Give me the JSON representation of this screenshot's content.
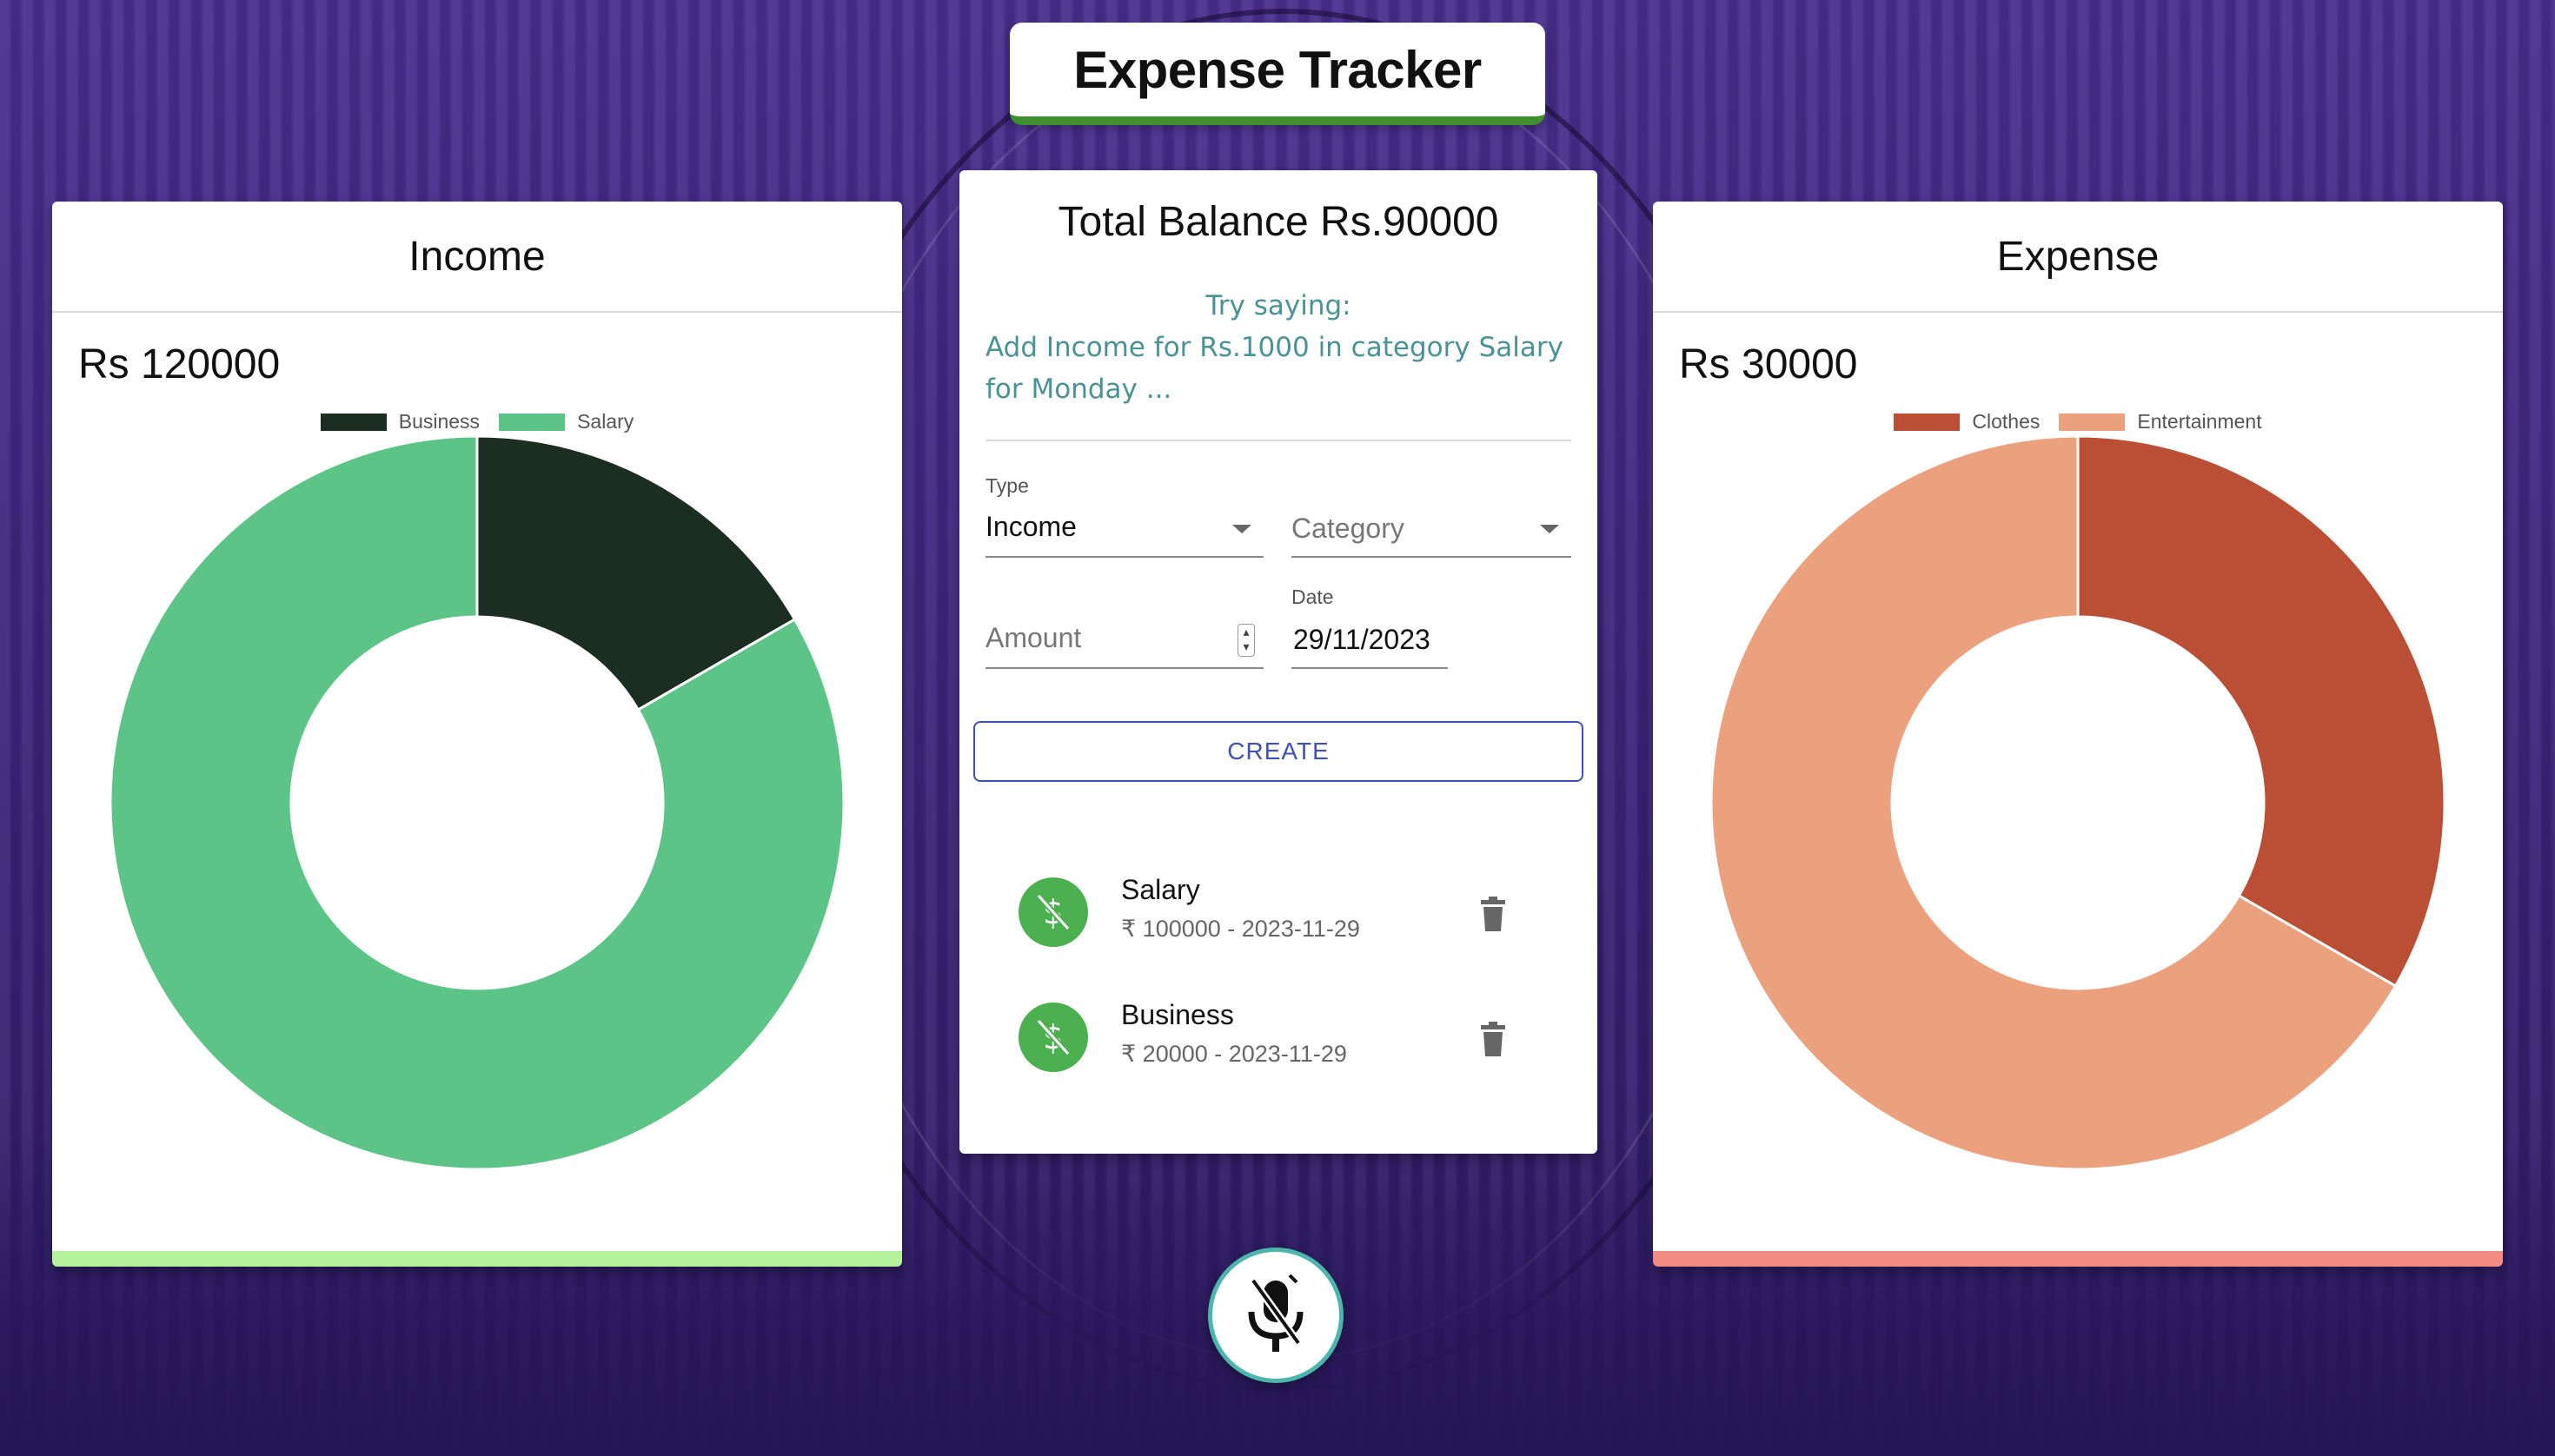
{
  "app": {
    "title": "Expense Tracker"
  },
  "income_card": {
    "heading": "Income",
    "total": "Rs 120000",
    "legend": [
      "Business",
      "Salary"
    ],
    "accent": "#b6f19b"
  },
  "expense_card": {
    "heading": "Expense",
    "total": "Rs 30000",
    "legend": [
      "Clothes",
      "Entertainment"
    ],
    "accent": "#f28b82"
  },
  "chart_data": [
    {
      "type": "pie",
      "categories": [
        "Business",
        "Salary"
      ],
      "values": [
        20000,
        100000
      ],
      "colors": [
        "#1c2e22",
        "#5cc486"
      ],
      "title": "",
      "legend_position": "top-center"
    },
    {
      "type": "pie",
      "categories": [
        "Clothes",
        "Entertainment"
      ],
      "values": [
        10000,
        20000
      ],
      "colors": [
        "#bb4f36",
        "#eba07e"
      ],
      "title": "",
      "legend_position": "top-center"
    }
  ],
  "form": {
    "balance": "Total Balance Rs.90000",
    "hint_title": "Try saying:",
    "hint_body": "Add Income for Rs.1000 in category Salary for Monday ...",
    "type_label": "Type",
    "type_value": "Income",
    "category_placeholder": "Category",
    "amount_placeholder": "Amount",
    "date_label": "Date",
    "date_value": "29/11/2023",
    "create_label": "CREATE"
  },
  "transactions": [
    {
      "name": "Salary",
      "detail": "₹ 100000 - 2023-11-29",
      "icon": "dollar-off-icon"
    },
    {
      "name": "Business",
      "detail": "₹ 20000 - 2023-11-29",
      "icon": "dollar-off-icon"
    }
  ],
  "mic": {
    "icon": "microphone-off-icon",
    "ring_color": "#4db6ac"
  },
  "colors": {
    "income_green": "#5cc486",
    "expense_orange": "#eba07e",
    "primary": "#3f51b5",
    "title_accent": "#3f8f2f"
  }
}
